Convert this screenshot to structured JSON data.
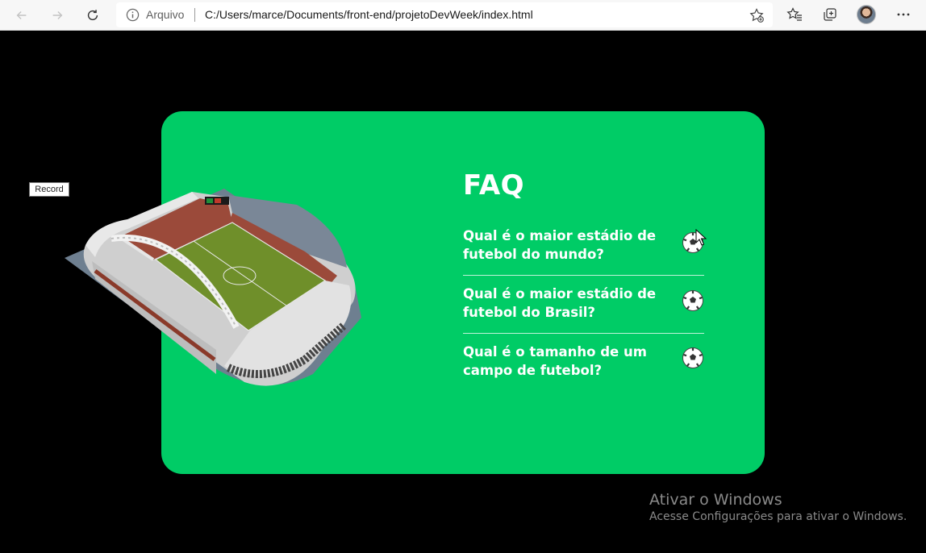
{
  "browser": {
    "scheme_label": "Arquivo",
    "url": "C:/Users/marce/Documents/front-end/projetoDevWeek/index.html"
  },
  "tooltip": {
    "text": "Record"
  },
  "faq": {
    "title": "FAQ",
    "items": [
      {
        "question": "Qual é o maior estádio de futebol do mundo?"
      },
      {
        "question": "Qual é o maior estádio de futebol do Brasil?"
      },
      {
        "question": "Qual é o tamanho de um campo de futebol?"
      }
    ]
  },
  "colors": {
    "card": "#00cc66",
    "background": "#000000",
    "text": "#ffffff"
  },
  "watermark": {
    "title": "Ativar o Windows",
    "subtitle": "Acesse Configurações para ativar o Windows."
  }
}
